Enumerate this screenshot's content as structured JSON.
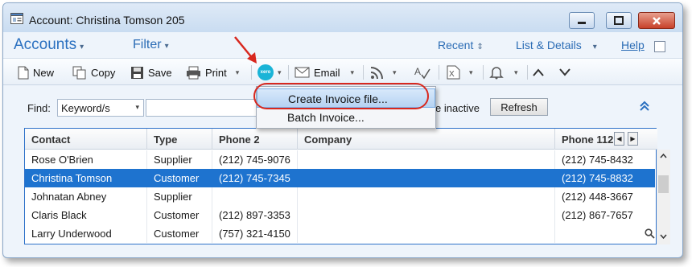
{
  "window": {
    "title": "Account:  Christina Tomson 205"
  },
  "menubar": {
    "accounts": "Accounts",
    "filter": "Filter",
    "recent": "Recent",
    "list_details": "List & Details",
    "help": "Help"
  },
  "toolbar": {
    "new": "New",
    "copy": "Copy",
    "save": "Save",
    "print": "Print",
    "xero": "xero",
    "email": "Email"
  },
  "find": {
    "label": "Find:",
    "mode": "Keyword/s",
    "query": "",
    "inactive_label": "e inactive",
    "refresh": "Refresh"
  },
  "popup": {
    "items": [
      "Create Invoice file...",
      "Batch Invoice..."
    ]
  },
  "grid": {
    "columns": [
      "Contact",
      "Type",
      "Phone 2",
      "Company",
      "Phone 112"
    ],
    "rows": [
      [
        "Rose O'Brien",
        "Supplier",
        "(212) 745-9076",
        "",
        "(212) 745-8432"
      ],
      [
        "Christina Tomson",
        "Customer",
        "(212) 745-7345",
        "",
        "(212) 745-8832"
      ],
      [
        "Johnatan Abney",
        "Supplier",
        "",
        "",
        "(212) 448-3667"
      ],
      [
        "Claris Black",
        "Customer",
        "(212) 897-3353",
        "",
        "(212) 867-7657"
      ],
      [
        "Larry Underwood",
        "Customer",
        "(757) 321-4150",
        "",
        ""
      ]
    ],
    "selected_row": 1
  },
  "colors": {
    "accent": "#1e73cf",
    "annotation": "#d8271e",
    "xero": "#1ab4d7"
  }
}
